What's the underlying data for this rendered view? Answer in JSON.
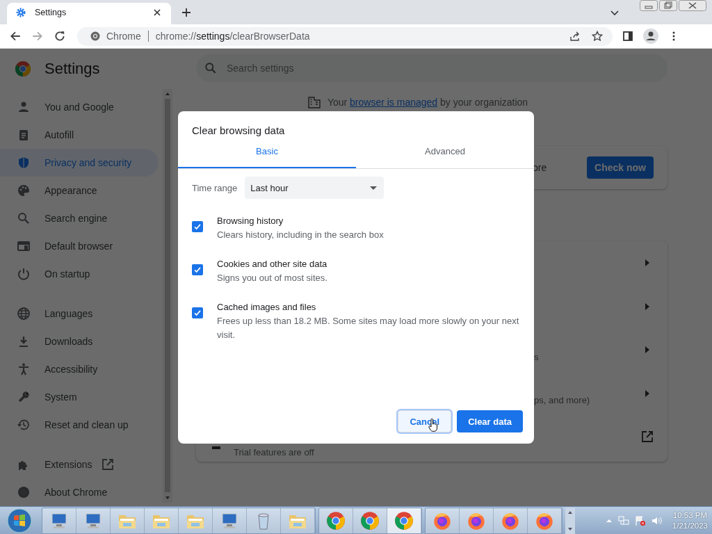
{
  "browser": {
    "tab": {
      "title": "Settings"
    },
    "omnibox": {
      "site_label": "Chrome",
      "url": "chrome://**settings**/clearBrowserData"
    }
  },
  "settings": {
    "title": "Settings",
    "search": {
      "placeholder": "Search settings"
    },
    "sidebar": {
      "items": [
        {
          "label": "You and Google",
          "selected": false,
          "kind": "page"
        },
        {
          "label": "Autofill",
          "selected": false,
          "kind": "page"
        },
        {
          "label": "Privacy and security",
          "selected": true,
          "kind": "page"
        },
        {
          "label": "Appearance",
          "selected": false,
          "kind": "page"
        },
        {
          "label": "Search engine",
          "selected": false,
          "kind": "page"
        },
        {
          "label": "Default browser",
          "selected": false,
          "kind": "page"
        },
        {
          "label": "On startup",
          "selected": false,
          "kind": "page"
        },
        {
          "label": "Languages",
          "selected": false,
          "kind": "page"
        },
        {
          "label": "Downloads",
          "selected": false,
          "kind": "page"
        },
        {
          "label": "Accessibility",
          "selected": false,
          "kind": "page"
        },
        {
          "label": "System",
          "selected": false,
          "kind": "page"
        },
        {
          "label": "Reset and clean up",
          "selected": false,
          "kind": "page"
        },
        {
          "label": "Extensions",
          "selected": false,
          "kind": "external"
        },
        {
          "label": "About Chrome",
          "selected": false,
          "kind": "page"
        }
      ]
    },
    "managed_notice": {
      "before": "Your",
      "link": "browser is managed",
      "after": "by your organization"
    },
    "safety_card": {
      "text": "ore",
      "button": "Check now"
    },
    "privacy_rows": [
      {
        "text": "",
        "kind": "arrow"
      },
      {
        "text": "",
        "kind": "arrow"
      },
      {
        "text": "s",
        "kind": "arrow"
      },
      {
        "text": "ps, and more)",
        "kind": "arrow"
      },
      {
        "text": "Trial features are off",
        "kind": "external"
      }
    ]
  },
  "dialog": {
    "title": "Clear browsing data",
    "tabs": [
      {
        "label": "Basic",
        "selected": true
      },
      {
        "label": "Advanced",
        "selected": false
      }
    ],
    "time_range": {
      "label": "Time range",
      "value": "Last hour"
    },
    "options": [
      {
        "title": "Browsing history",
        "description": "Clears history, including in the search box",
        "checked": true
      },
      {
        "title": "Cookies and other site data",
        "description": "Signs you out of most sites.",
        "checked": true
      },
      {
        "title": "Cached images and files",
        "description": "Frees up less than 18.2 MB. Some sites may load more slowly on your next visit.",
        "checked": true
      }
    ],
    "buttons": [
      {
        "label": "Cancel",
        "kind": "secondary",
        "focused": true
      },
      {
        "label": "Clear data",
        "kind": "primary",
        "focused": false
      }
    ]
  },
  "taskbar": {
    "clock": {
      "time": "10:53 PM",
      "date": "1/21/2023"
    }
  }
}
